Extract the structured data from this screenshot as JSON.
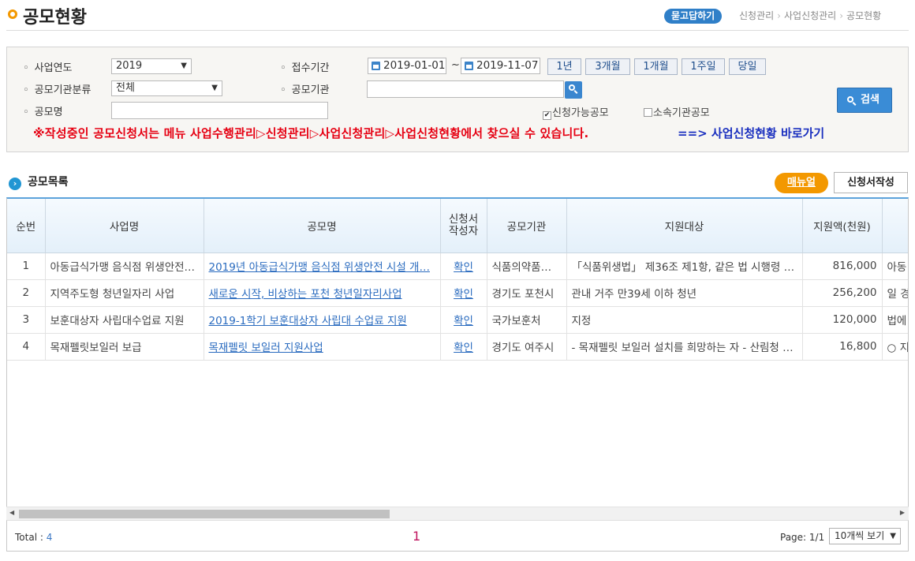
{
  "header": {
    "title": "공모현황",
    "qa_label": "묻고답하기",
    "breadcrumb": [
      "신청관리",
      "사업신청관리",
      "공모현황"
    ]
  },
  "search": {
    "year_label": "사업연도",
    "year_value": "2019",
    "period_label": "접수기간",
    "date_from": "2019-01-01",
    "date_to": "2019-11-07",
    "tilde": "~",
    "period_buttons": [
      "1년",
      "3개월",
      "1개월",
      "1주일",
      "당일"
    ],
    "org_type_label": "공모기관분류",
    "org_type_value": "전체",
    "org_label": "공모기관",
    "org_value": "",
    "name_label": "공모명",
    "name_value": "",
    "check_available": "신청가능공모",
    "check_affiliated": "소속기관공모",
    "search_button": "검색",
    "notice": "※작성중인 공모신청서는 메뉴 사업수행관리▷신청관리▷사업신청관리▷사업신청현황에서 찾으실 수 있습니다.",
    "shortcut_link": "==> 사업신청현황 바로가기"
  },
  "list": {
    "section_title": "공모목록",
    "manual_button": "매뉴얼",
    "write_button": "신청서작성",
    "columns": [
      "순번",
      "사업명",
      "공모명",
      "신청서\n작성자",
      "공모기관",
      "지원대상",
      "지원액(천원)",
      ""
    ],
    "rows": [
      [
        "1",
        "아동급식가맹 음식점 위생안전…",
        "2019년 아동급식가맹 음식점 위생안전 시설 개…",
        "확인",
        "식품의약품…",
        "「식품위생법」 제36조 제1항, 같은 법 시행령 제…",
        "816,000",
        "아동"
      ],
      [
        "2",
        "지역주도형 청년일자리 사업",
        "새로운 시작, 비상하는 포천 청년일자리사업",
        "확인",
        "경기도 포천시",
        "관내 거주 만39세 이하 청년",
        "256,200",
        "일 경"
      ],
      [
        "3",
        "보훈대상자 사립대수업료 지원",
        "2019-1학기 보훈대상자 사립대 수업료 지원",
        "확인",
        "국가보훈처",
        "지정",
        "120,000",
        "법에"
      ],
      [
        "4",
        "목재펠릿보일러 보급",
        "목재펠릿 보일러 지원사업",
        "확인",
        "경기도 여주시",
        "- 목재펠릿 보일러 설치를 희망하는 자 - 산림청 …",
        "16,800",
        "○ 지"
      ]
    ]
  },
  "footer": {
    "total_label": "Total : ",
    "total_value": "4",
    "current_page": "1",
    "page_info": "Page: 1/1",
    "per_page": "10개씩 보기"
  }
}
